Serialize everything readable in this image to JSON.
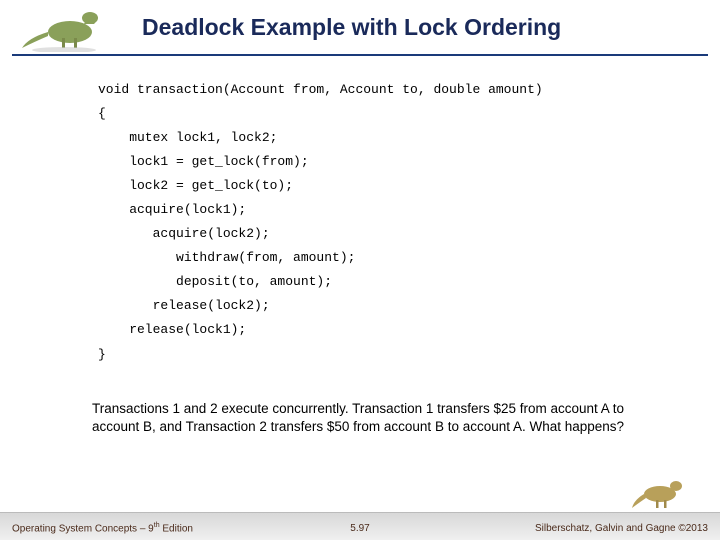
{
  "title": "Deadlock Example with Lock Ordering",
  "code": {
    "l0": "void transaction(Account from, Account to, double amount)",
    "l1": "{",
    "l2": "    mutex lock1, lock2;",
    "l3": "    lock1 = get_lock(from);",
    "l4": "    lock2 = get_lock(to);",
    "l5": "    acquire(lock1);",
    "l6": "       acquire(lock2);",
    "l7": "          withdraw(from, amount);",
    "l8": "          deposit(to, amount);",
    "l9": "       release(lock2);",
    "l10": "    release(lock1);",
    "l11": "}"
  },
  "body": "Transactions 1 and 2 execute concurrently.  Transaction  1 transfers $25 from account A to account B, and Transaction 2 transfers $50 from account B to account A. What happens?",
  "footer": {
    "left_a": "Operating System Concepts – 9",
    "left_b": " Edition",
    "left_sup": "th",
    "center": "5.97",
    "right": "Silberschatz, Galvin and Gagne ©2013"
  }
}
